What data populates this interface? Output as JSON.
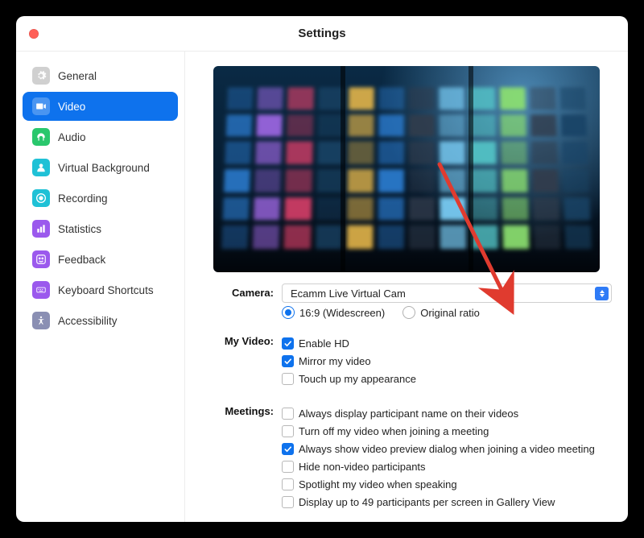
{
  "window": {
    "title": "Settings"
  },
  "sidebar": {
    "items": [
      {
        "label": "General",
        "icon": "gear-icon",
        "tint": "g-general",
        "active": false
      },
      {
        "label": "Video",
        "icon": "video-icon",
        "tint": "g-video",
        "active": true
      },
      {
        "label": "Audio",
        "icon": "headphones-icon",
        "tint": "g-audio",
        "active": false
      },
      {
        "label": "Virtual Background",
        "icon": "person-icon",
        "tint": "g-vbg",
        "active": false
      },
      {
        "label": "Recording",
        "icon": "record-icon",
        "tint": "g-rec",
        "active": false
      },
      {
        "label": "Statistics",
        "icon": "chart-icon",
        "tint": "g-stats",
        "active": false
      },
      {
        "label": "Feedback",
        "icon": "smile-icon",
        "tint": "g-feed",
        "active": false
      },
      {
        "label": "Keyboard Shortcuts",
        "icon": "keyboard-icon",
        "tint": "g-keys",
        "active": false
      },
      {
        "label": "Accessibility",
        "icon": "accessibility-icon",
        "tint": "g-access",
        "active": false
      }
    ]
  },
  "video": {
    "camera_label": "Camera:",
    "camera_value": "Ecamm Live Virtual Cam",
    "aspect": {
      "widescreen": "16:9 (Widescreen)",
      "original": "Original ratio",
      "selected": "widescreen"
    },
    "my_video_label": "My Video:",
    "my_video": [
      {
        "label": "Enable HD",
        "checked": true
      },
      {
        "label": "Mirror my video",
        "checked": true
      },
      {
        "label": "Touch up my appearance",
        "checked": false
      }
    ],
    "meetings_label": "Meetings:",
    "meetings": [
      {
        "label": "Always display participant name on their videos",
        "checked": false
      },
      {
        "label": "Turn off my video when joining a meeting",
        "checked": false
      },
      {
        "label": "Always show video preview dialog when joining a video meeting",
        "checked": true
      },
      {
        "label": "Hide non-video participants",
        "checked": false
      },
      {
        "label": "Spotlight my video when speaking",
        "checked": false
      },
      {
        "label": "Display up to 49 participants per screen in Gallery View",
        "checked": false
      }
    ]
  },
  "annotation": {
    "arrow_color": "#e03b2f"
  }
}
